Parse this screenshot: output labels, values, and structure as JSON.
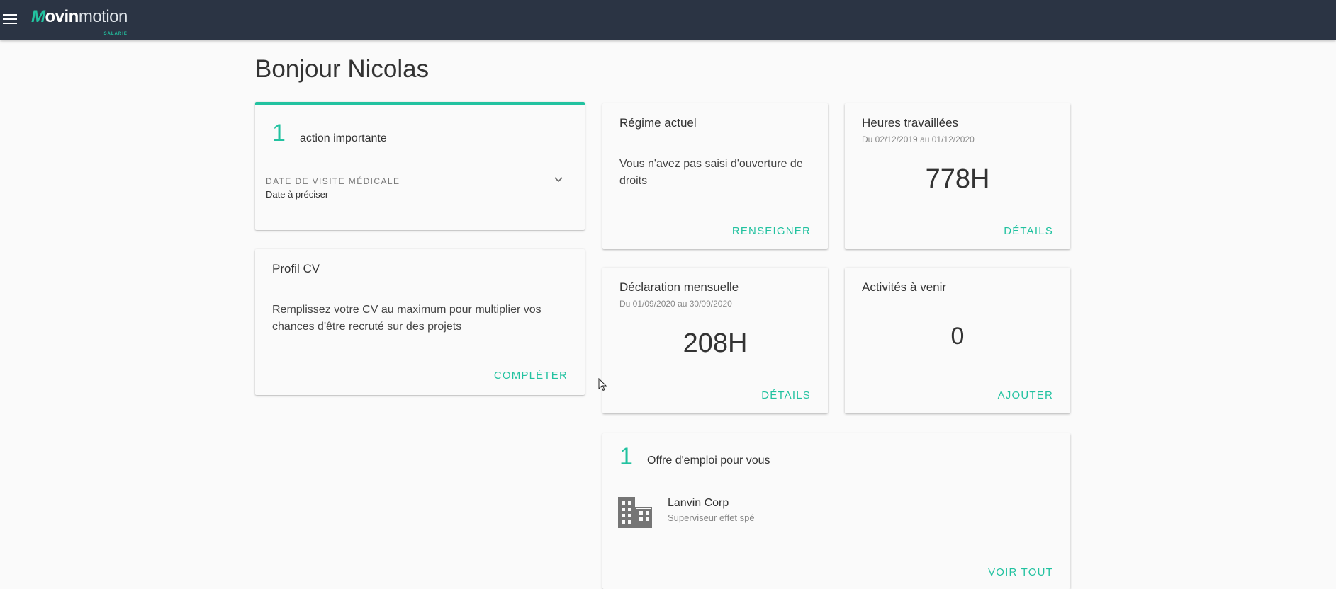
{
  "app": {
    "logo_mark": "M",
    "logo_bold": "ovin",
    "logo_light": "motion",
    "logo_sub": "SALARIE"
  },
  "greeting": "Bonjour Nicolas",
  "actions_card": {
    "count": "1",
    "label": "action importante",
    "item_title": "DATE DE VISITE MÉDICALE",
    "item_value": "Date à préciser"
  },
  "profile_card": {
    "title": "Profil CV",
    "text": "Remplissez votre CV au maximum pour multiplier vos chances d'être recruté sur des projets",
    "button": "COMPLÉTER"
  },
  "regime_card": {
    "title": "Régime actuel",
    "text": "Vous n'avez pas saisi d'ouverture de droits",
    "button": "RENSEIGNER"
  },
  "hours_card": {
    "title": "Heures travaillées",
    "period": "Du 02/12/2019 au 01/12/2020",
    "value": "778H",
    "button": "DÉTAILS"
  },
  "monthly_card": {
    "title": "Déclaration mensuelle",
    "period": "Du 01/09/2020 au 30/09/2020",
    "value": "208H",
    "button": "DÉTAILS"
  },
  "activities_card": {
    "title": "Activités à venir",
    "value": "0",
    "button": "AJOUTER"
  },
  "jobs_card": {
    "count": "1",
    "label": "Offre d'emploi pour vous",
    "company": "Lanvin Corp",
    "position": "Superviseur effet spé",
    "button": "VOIR TOUT"
  },
  "colors": {
    "topbar": "#2b3444",
    "accent": "#22c2a0",
    "background": "#fafafa"
  }
}
